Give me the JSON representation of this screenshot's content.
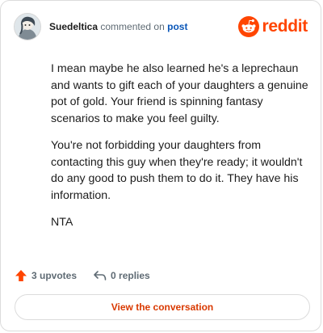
{
  "header": {
    "username": "Suedeltica",
    "verb": "commented on",
    "post_link": "post",
    "brand_wordmark": "reddit",
    "brand_icon": "reddit-snoo-icon",
    "brand_color": "#ff4500"
  },
  "comment": {
    "paragraphs": [
      "I mean maybe he also learned he's a leprechaun and wants to gift each of your daughters a genuine pot of gold. Your friend is spinning fantasy scenarios to make you feel guilty.",
      "You're not forbidding your daughters from contacting this guy when they're ready; it wouldn't do any good to push them to do it. They have his information.",
      "NTA"
    ]
  },
  "actions": {
    "upvotes": "3 upvotes",
    "upvote_icon": "upvote-arrow-icon",
    "replies": "0 replies",
    "reply_icon": "reply-arrow-icon"
  },
  "cta": {
    "label": "View the conversation"
  },
  "colors": {
    "accent": "#ff4500",
    "link": "#0a56b8",
    "cta_text": "#d93900",
    "muted": "#5f6b74"
  }
}
